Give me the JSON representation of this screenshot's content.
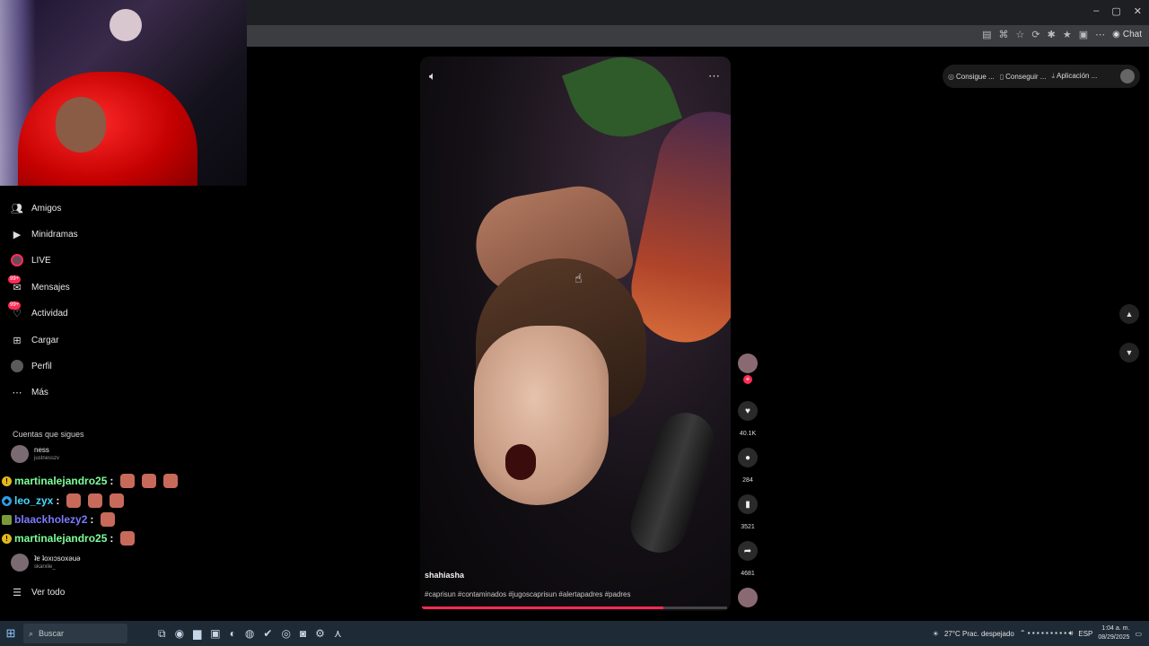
{
  "browser": {
    "window_controls": [
      "–",
      "▢",
      "✕"
    ],
    "chat_button": "Chat"
  },
  "sidebar": {
    "items": [
      {
        "label": "Amigos",
        "icon": "friends-icon"
      },
      {
        "label": "Minidramas",
        "icon": "minidramas-icon"
      },
      {
        "label": "LIVE",
        "icon": "live-icon"
      },
      {
        "label": "Mensajes",
        "icon": "messages-icon",
        "badge": "99+"
      },
      {
        "label": "Actividad",
        "icon": "activity-icon",
        "badge": "99+"
      },
      {
        "label": "Cargar",
        "icon": "upload-icon"
      },
      {
        "label": "Perfil",
        "icon": "profile-icon"
      },
      {
        "label": "Más",
        "icon": "more-icon"
      }
    ],
    "following_title": "Cuentas que sigues",
    "following": [
      {
        "name": "ness",
        "username": "justnesszv"
      },
      {
        "name": "ʇɐ ʇoxıɔsoxəuǝ",
        "username": "skarxlie_"
      }
    ],
    "see_all": "Ver todo"
  },
  "chat": {
    "messages": [
      {
        "user": "martinalejandro25",
        "color": "#7dff9a",
        "badge": "!",
        "emotes": 3
      },
      {
        "user": "leo_zyx",
        "color": "#46d9ff",
        "badge": "◆",
        "emotes": 3
      },
      {
        "user": "blaackholezy2",
        "color": "#7a7cff",
        "badge": "",
        "emotes": 1
      },
      {
        "user": "martinalejandro25",
        "color": "#7dff9a",
        "badge": "!",
        "emotes": 1
      }
    ],
    "separator": ":"
  },
  "video": {
    "username": "shahiasha",
    "hashtags": "#caprisun #contaminados #jugoscaprisun #alertapadres #padres",
    "progress": 0.79
  },
  "actions": {
    "likes": "40.1K",
    "comments": "284",
    "saves": "3521",
    "shares": "4681"
  },
  "top_actions": [
    {
      "label": "Consigue ...",
      "icon": "coin-icon"
    },
    {
      "label": "Conseguir ...",
      "icon": "phone-icon"
    },
    {
      "label": "Aplicación ...",
      "icon": "download-icon"
    }
  ],
  "taskbar": {
    "search_placeholder": "Buscar",
    "weather": "27°C  Prac. despejado",
    "lang": "ESP",
    "time": "1:04 a. m.",
    "date": "08/29/2025"
  }
}
